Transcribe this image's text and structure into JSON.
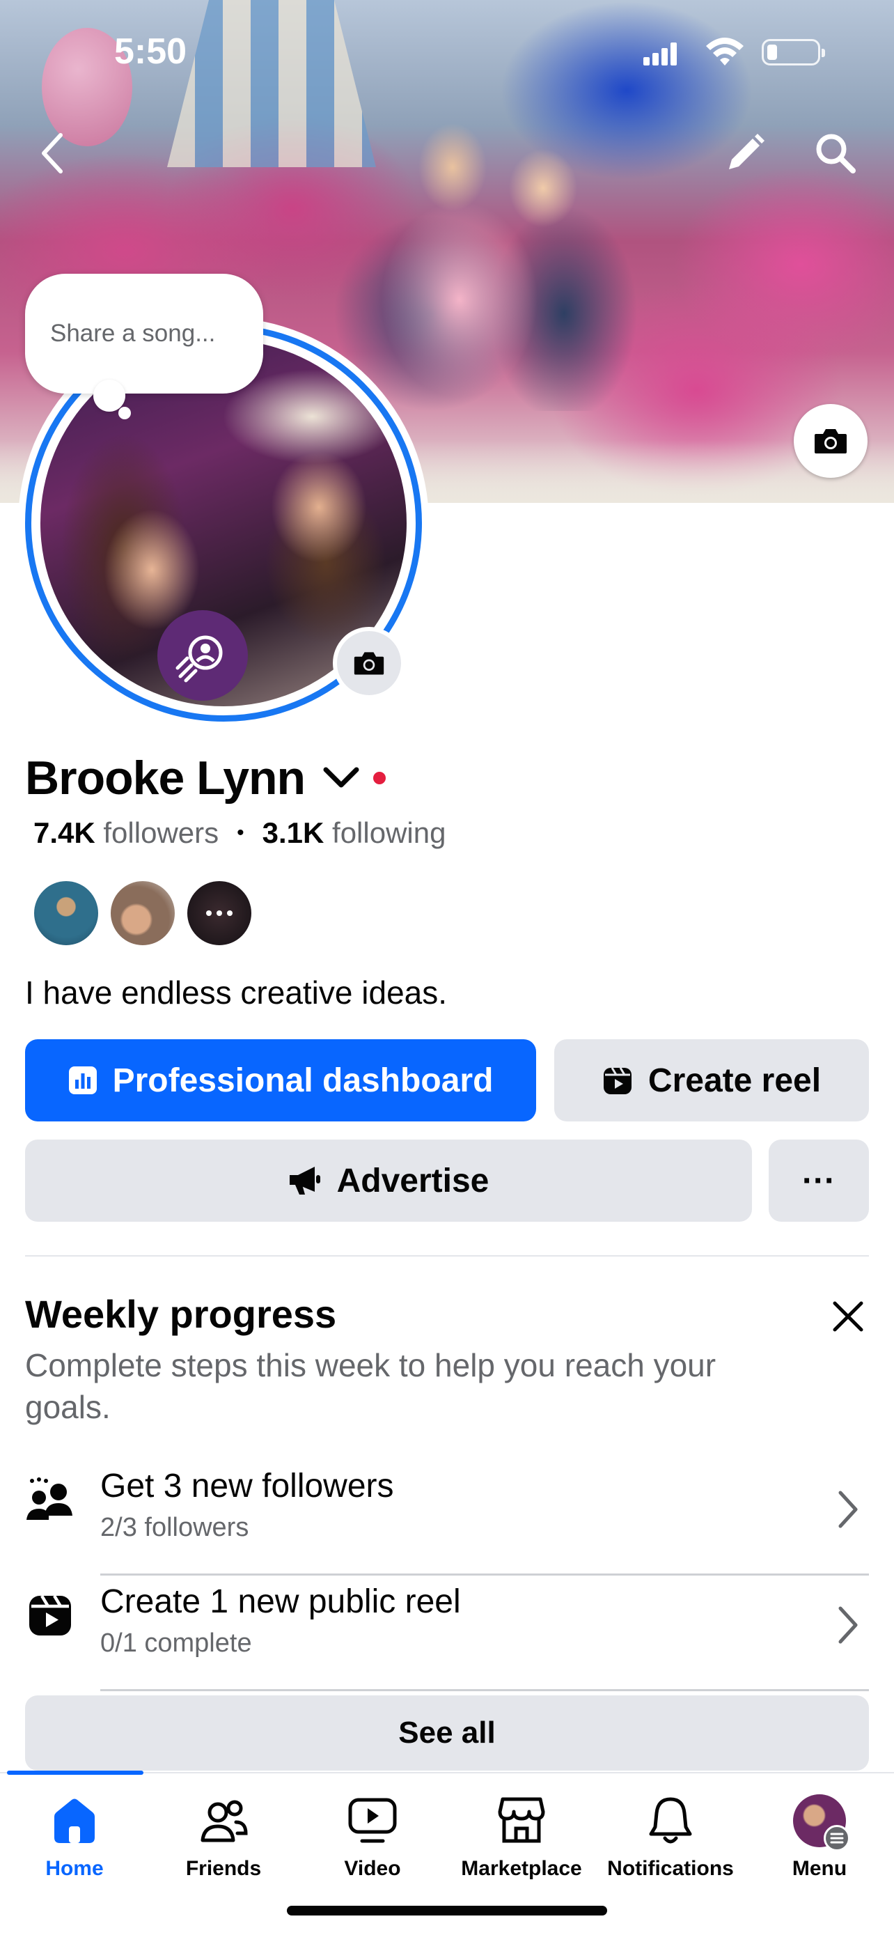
{
  "status_bar": {
    "time": "5:50"
  },
  "cover": {
    "edit_icon": "pencil-icon",
    "search_icon": "search-icon",
    "camera_icon": "camera-icon"
  },
  "avatar": {
    "bubble_text": "Share a song...",
    "ring_color": "#1877f2"
  },
  "profile": {
    "name": "Brooke Lynn",
    "followers_count": "7.4K",
    "followers_label": "followers",
    "following_count": "3.1K",
    "following_label": "following",
    "bio": "I have endless creative ideas."
  },
  "actions": {
    "professional_dashboard": "Professional dashboard",
    "create_reel": "Create reel",
    "advertise": "Advertise",
    "more": "···"
  },
  "weekly_progress": {
    "title": "Weekly progress",
    "subtitle": "Complete steps this week to help you reach your goals.",
    "tasks": [
      {
        "title": "Get 3 new followers",
        "status": "2/3 followers",
        "icon": "people-icon"
      },
      {
        "title": "Create 1 new public reel",
        "status": "0/1 complete",
        "icon": "reel-icon"
      }
    ],
    "see_all": "See all"
  },
  "tabs": [
    {
      "label": "Home",
      "icon": "home-icon",
      "active": true
    },
    {
      "label": "Friends",
      "icon": "friends-icon",
      "active": false
    },
    {
      "label": "Video",
      "icon": "video-icon",
      "active": false
    },
    {
      "label": "Marketplace",
      "icon": "marketplace-icon",
      "active": false
    },
    {
      "label": "Notifications",
      "icon": "bell-icon",
      "active": false
    },
    {
      "label": "Menu",
      "icon": "menu-avatar",
      "active": false
    }
  ],
  "colors": {
    "accent": "#0866ff",
    "button_gray": "#e4e6eb",
    "secondary_text": "#65676b",
    "online_dot": "#e41e3f"
  }
}
